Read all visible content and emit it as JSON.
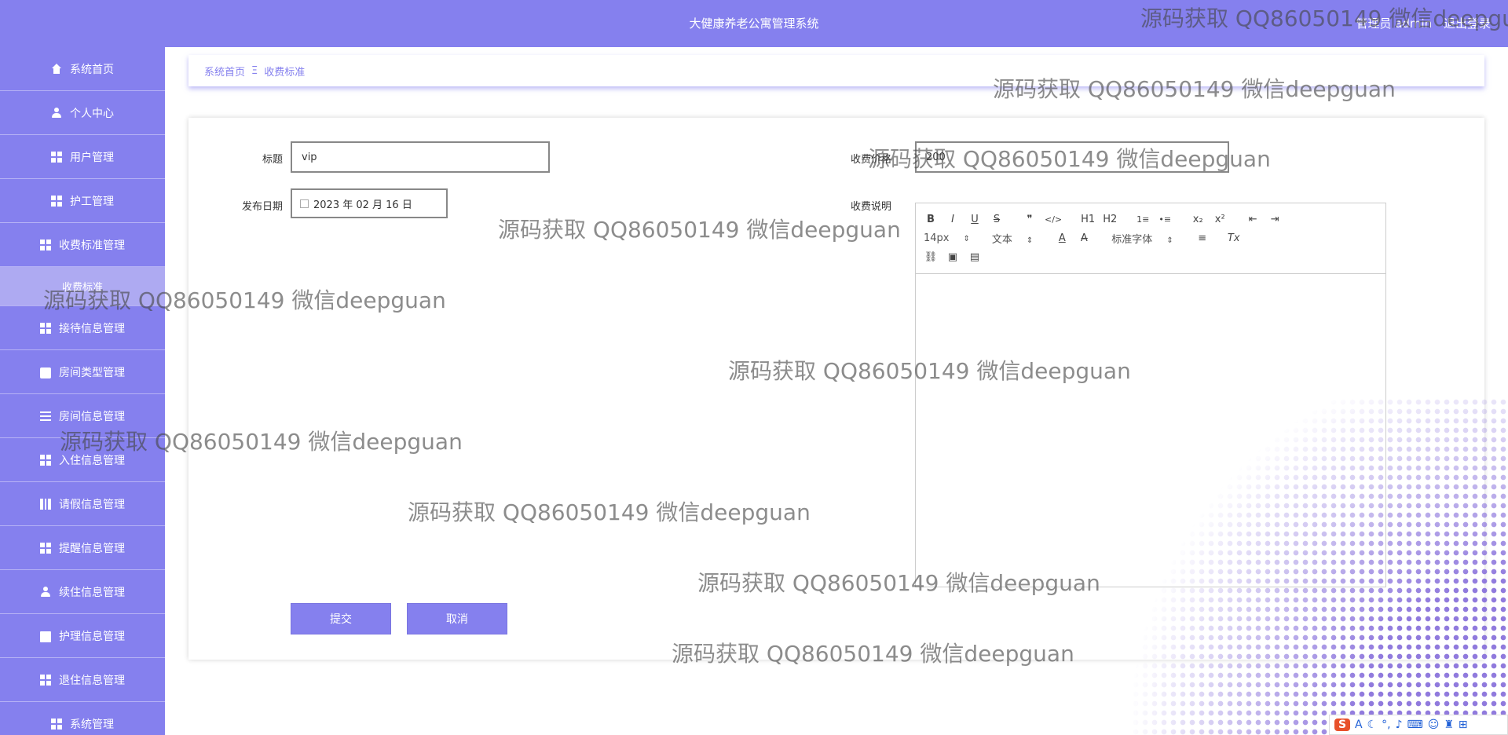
{
  "header": {
    "title": "大健康养老公寓管理系统",
    "user_label": "管理员 admin",
    "logout_label": "退出登录"
  },
  "sidebar": {
    "items": [
      {
        "label": "系统首页",
        "icon": "home-icon"
      },
      {
        "label": "个人中心",
        "icon": "user-icon"
      },
      {
        "label": "用户管理",
        "icon": "grid-icon"
      },
      {
        "label": "护工管理",
        "icon": "grid-icon"
      },
      {
        "label": "收费标准管理",
        "icon": "grid-icon"
      },
      {
        "label": "收费标准",
        "icon": ""
      },
      {
        "label": "接待信息管理",
        "icon": "grid-icon"
      },
      {
        "label": "房间类型管理",
        "icon": "briefcase-icon"
      },
      {
        "label": "房间信息管理",
        "icon": "list-icon"
      },
      {
        "label": "入住信息管理",
        "icon": "grid-icon"
      },
      {
        "label": "请假信息管理",
        "icon": "table-icon"
      },
      {
        "label": "提醒信息管理",
        "icon": "grid-icon"
      },
      {
        "label": "续住信息管理",
        "icon": "user-icon"
      },
      {
        "label": "护理信息管理",
        "icon": "ticket-icon"
      },
      {
        "label": "退住信息管理",
        "icon": "grid-icon"
      },
      {
        "label": "系统管理",
        "icon": "grid-icon"
      }
    ]
  },
  "breadcrumb": {
    "home": "系统首页",
    "separator": "Ξ",
    "current": "收费标准"
  },
  "form": {
    "title_label": "标题",
    "title_value": "vip",
    "price_label": "收费价格",
    "price_value": "200",
    "date_label": "发布日期",
    "date_value": "2023 年 02 月 16 日",
    "desc_label": "收费说明",
    "submit_label": "提交",
    "cancel_label": "取消"
  },
  "editor": {
    "row1": [
      "B",
      "I",
      "U",
      "S",
      "❞",
      "</>",
      "H1",
      "H2",
      "1≡",
      "•≡",
      "x₂",
      "x²",
      "⇤",
      "⇥"
    ],
    "size_select": "14px",
    "format_select": "文本",
    "color_btn": "A",
    "bg_btn": "A̶",
    "font_select": "标准字体",
    "align_btn": "≡",
    "clear_btn": "Tx"
  },
  "watermark": "源码获取 QQ86050149 微信deepguan",
  "taskbar": {
    "ime_logo": "S",
    "ime_mode": "A"
  },
  "colors": {
    "primary": "#8580ee",
    "sidebar_sub": "#aeaaf2"
  }
}
